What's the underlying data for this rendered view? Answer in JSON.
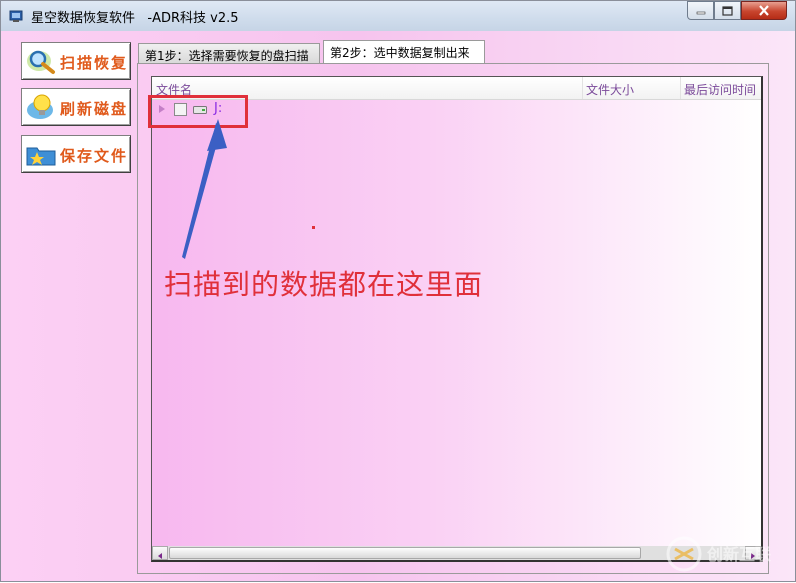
{
  "window": {
    "title": "星空数据恢复软件   -ADR科技 v2.5"
  },
  "sidebar": {
    "buttons": [
      {
        "label": "扫描恢复",
        "icon": "scan-magnifier-icon"
      },
      {
        "label": "刷新磁盘",
        "icon": "refresh-bulb-icon"
      },
      {
        "label": "保存文件",
        "icon": "save-folder-icon"
      }
    ]
  },
  "tabs": [
    {
      "label": "第1步：选择需要恢复的盘扫描",
      "active": false
    },
    {
      "label": "第2步：选中数据复制出来",
      "active": true
    }
  ],
  "list": {
    "columns": [
      "文件名",
      "文件大小",
      "最后访问时间"
    ],
    "rows": [
      {
        "label": "J:",
        "checked": false,
        "icon": "drive-icon"
      }
    ]
  },
  "annotation": {
    "text": "扫描到的数据都在这里面",
    "color": "#e0303a"
  },
  "watermark": {
    "text": "创新互联"
  },
  "colors": {
    "accent_orange": "#e05a1c",
    "header_text": "#7b4a9a",
    "drive_label": "#8a2be2"
  }
}
